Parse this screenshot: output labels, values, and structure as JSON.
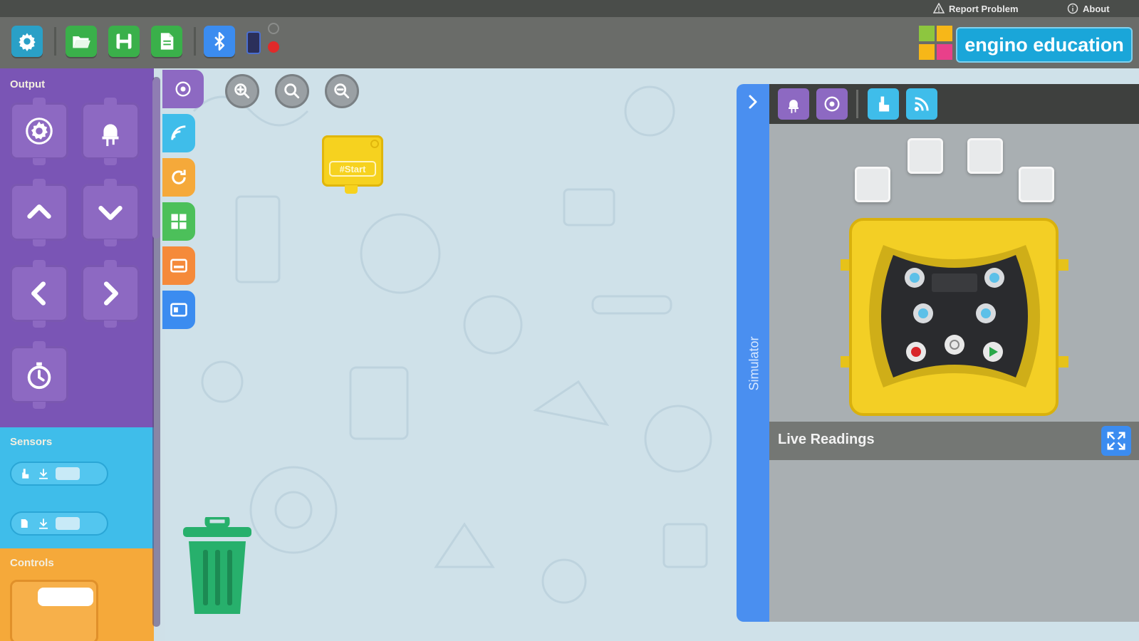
{
  "topbar": {
    "report_problem": "Report Problem",
    "about": "About"
  },
  "toolbar": {
    "buttons": [
      {
        "icon": "gear-icon",
        "color": "#2aa0c7"
      },
      {
        "icon": "folder-open-icon",
        "color": "#3ab04a"
      },
      {
        "icon": "save-icon",
        "color": "#3ab04a"
      },
      {
        "icon": "new-file-icon",
        "color": "#3ab04a"
      },
      {
        "icon": "bluetooth-icon",
        "color": "#3b8cf0"
      }
    ],
    "connection_indicator": {
      "state": "disconnected"
    }
  },
  "brand": {
    "name": "engino education",
    "accent": "#1aa6d9"
  },
  "palette": {
    "categories": [
      {
        "title": "Output",
        "color": "#7a55b5"
      },
      {
        "title": "Sensors",
        "color": "#3fbdea"
      },
      {
        "title": "Controls",
        "color": "#f5a93a"
      }
    ],
    "output_blocks": [
      "motor-gear-icon",
      "led-icon",
      "arrow-up-icon",
      "arrow-down-icon",
      "arrow-left-icon",
      "arrow-right-icon",
      "timer-icon"
    ]
  },
  "category_tabs": [
    {
      "icon": "gear-icon",
      "color": "#8d69c2"
    },
    {
      "icon": "wifi-sensor-icon",
      "color": "#3fbdea"
    },
    {
      "icon": "loop-icon",
      "color": "#f5a93a"
    },
    {
      "icon": "grid-icon",
      "color": "#4cc05a"
    },
    {
      "icon": "variable-icon",
      "color": "#f58a3a"
    },
    {
      "icon": "display-icon",
      "color": "#3b8cf0"
    }
  ],
  "workspace": {
    "start_block_label": "#Start"
  },
  "simulator": {
    "tab_label": "Simulator",
    "live_readings": "Live Readings"
  }
}
